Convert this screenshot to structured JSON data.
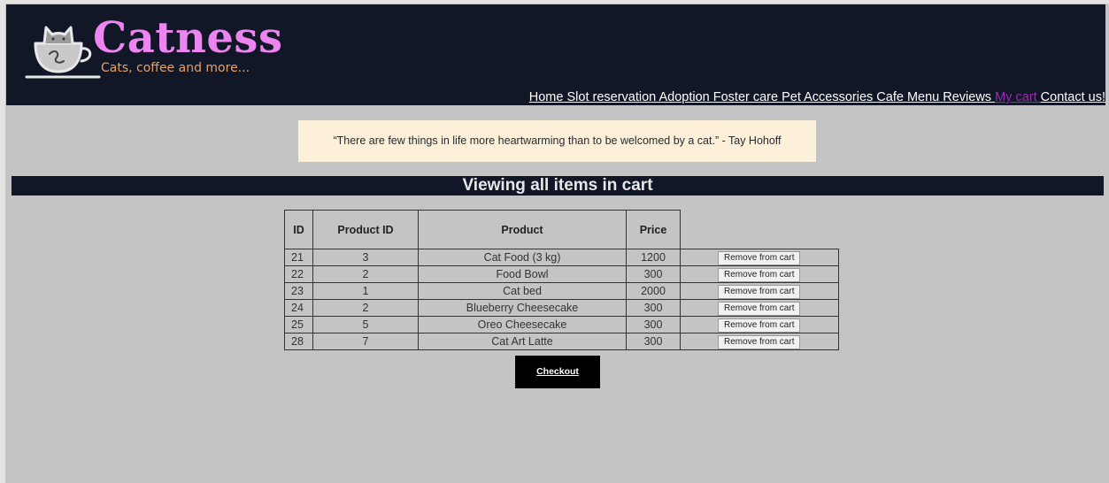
{
  "brand": {
    "name": "Catness",
    "tagline": "Cats, coffee and more...",
    "colors": {
      "title": "#ec85f0",
      "tagline": "#e6a06a",
      "header_bg": "#111727"
    }
  },
  "nav": {
    "items": [
      {
        "label": "Home",
        "active": false
      },
      {
        "label": "Slot reservation",
        "active": false
      },
      {
        "label": "Adoption",
        "active": false
      },
      {
        "label": "Foster care",
        "active": false
      },
      {
        "label": "Pet Accessories",
        "active": false
      },
      {
        "label": "Cafe Menu",
        "active": false
      },
      {
        "label": "Reviews",
        "active": false
      },
      {
        "label": "My cart",
        "active": true
      },
      {
        "label": "Contact us!",
        "active": false
      }
    ],
    "active_color": "#9b2ab5"
  },
  "quote": "“There are few things in life more heartwarming than to be welcomed by a cat.” - Tay Hohoff",
  "page_title": "Viewing all items in cart",
  "cart": {
    "columns": [
      "ID",
      "Product ID",
      "Product",
      "Price"
    ],
    "rows": [
      {
        "id": "21",
        "product_id": "3",
        "product": "Cat Food (3 kg)",
        "price": "1200",
        "action": "Remove from cart"
      },
      {
        "id": "22",
        "product_id": "2",
        "product": "Food Bowl",
        "price": "300",
        "action": "Remove from cart"
      },
      {
        "id": "23",
        "product_id": "1",
        "product": "Cat bed",
        "price": "2000",
        "action": "Remove from cart"
      },
      {
        "id": "24",
        "product_id": "2",
        "product": "Blueberry Cheesecake",
        "price": "300",
        "action": "Remove from cart"
      },
      {
        "id": "25",
        "product_id": "5",
        "product": "Oreo Cheesecake",
        "price": "300",
        "action": "Remove from cart"
      },
      {
        "id": "28",
        "product_id": "7",
        "product": "Cat Art Latte",
        "price": "300",
        "action": "Remove from cart"
      }
    ]
  },
  "checkout_label": "Checkout",
  "icons": {
    "logo": "cat-in-coffee-cup-icon"
  }
}
